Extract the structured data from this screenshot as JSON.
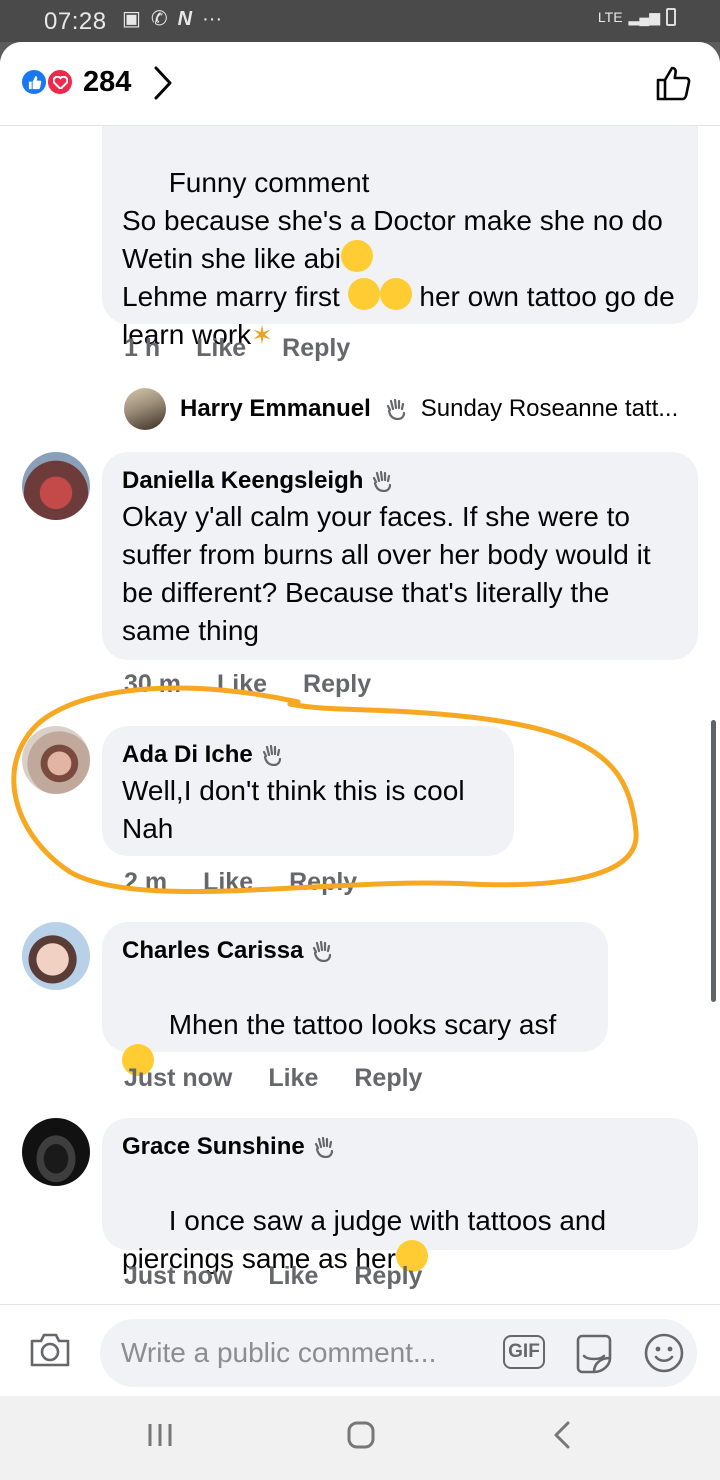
{
  "status_bar": {
    "time": "07:28",
    "network": "LTE"
  },
  "reactions": {
    "count": "284"
  },
  "comments": [
    {
      "body": "Funny comment\nSo because she's a Doctor make she no do Wetin she like abi",
      "body2": "Lehme marry first",
      "body3": " her own tattoo go de learn work",
      "time": "1 h",
      "like": "Like",
      "reply": "Reply"
    },
    {
      "author": "Harry Emmanuel",
      "preview": "Sunday Roseanne tatt..."
    },
    {
      "author": "Daniella Keengsleigh",
      "body": "Okay y'all calm your faces. If she were to suffer from burns all over her body would it be different? Because that's literally the same thing",
      "time": "30 m",
      "like": "Like",
      "reply": "Reply"
    },
    {
      "author": "Ada Di Iche",
      "body": "Well,I don't think this is cool Nah",
      "time": "2 m",
      "like": "Like",
      "reply": "Reply"
    },
    {
      "author": "Charles Carissa",
      "body": "Mhen the tattoo looks scary asf",
      "time": "Just now",
      "like": "Like",
      "reply": "Reply"
    },
    {
      "author": "Grace Sunshine",
      "body": "I once saw a judge with tattoos and piercings same as her",
      "time": "Just now",
      "like": "Like",
      "reply": "Reply"
    }
  ],
  "composer": {
    "placeholder": "Write a public comment...",
    "gif_label": "GIF"
  },
  "icons": {
    "like": "like-icon",
    "love": "love-icon",
    "thumb": "thumbs-up-outline-icon",
    "camera": "camera-icon",
    "sticker": "sticker-icon",
    "emoji": "smiley-icon",
    "wave": "waving-hand-icon"
  },
  "colors": {
    "accent": "#1877f2",
    "love": "#f02849",
    "bubble": "#f0f2f5",
    "meta": "#65676b",
    "annotation": "#f7a823"
  }
}
